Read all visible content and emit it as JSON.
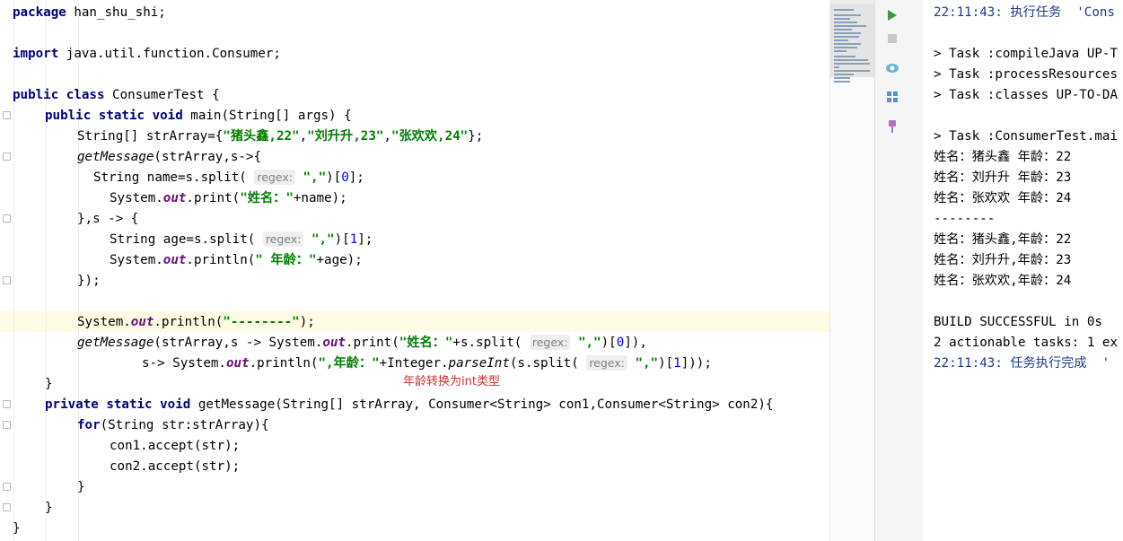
{
  "editor": {
    "lines": [
      {
        "row": 0,
        "segs": [
          {
            "t": "package",
            "c": "kw"
          },
          {
            "t": " han_shu_shi;"
          }
        ]
      },
      {
        "row": 2,
        "segs": [
          {
            "t": "import",
            "c": "kw"
          },
          {
            "t": " java.util.function.Consumer;"
          }
        ]
      },
      {
        "row": 4,
        "segs": [
          {
            "t": "public",
            "c": "kw"
          },
          {
            "t": " "
          },
          {
            "t": "class",
            "c": "kw"
          },
          {
            "t": " ConsumerTest {"
          }
        ]
      },
      {
        "row": 5,
        "indent": 36,
        "segs": [
          {
            "t": "public",
            "c": "kw"
          },
          {
            "t": " "
          },
          {
            "t": "static",
            "c": "kw"
          },
          {
            "t": " "
          },
          {
            "t": "void",
            "c": "kw"
          },
          {
            "t": " main(String[] args) {"
          }
        ]
      },
      {
        "row": 6,
        "indent": 72,
        "segs": [
          {
            "t": "String[] strArray={"
          },
          {
            "t": "\"猪头鑫,22\"",
            "c": "str"
          },
          {
            "t": ","
          },
          {
            "t": "\"刘升升,23\"",
            "c": "str"
          },
          {
            "t": ","
          },
          {
            "t": "\"张欢欢,24\"",
            "c": "str"
          },
          {
            "t": "};"
          }
        ]
      },
      {
        "row": 7,
        "indent": 72,
        "segs": [
          {
            "t": "getMessage",
            "c": "it"
          },
          {
            "t": "(strArray,s->{"
          }
        ]
      },
      {
        "row": 8,
        "indent": 90,
        "segs": [
          {
            "t": "String name=s.split( "
          },
          {
            "t": "regex:",
            "c": "hint"
          },
          {
            "t": " "
          },
          {
            "t": "\",\"",
            "c": "str"
          },
          {
            "t": ")["
          },
          {
            "t": "0",
            "c": "num"
          },
          {
            "t": "];"
          }
        ]
      },
      {
        "row": 9,
        "indent": 108,
        "segs": [
          {
            "t": "System."
          },
          {
            "t": "out",
            "c": "fld"
          },
          {
            "t": ".print("
          },
          {
            "t": "\"姓名：\"",
            "c": "str"
          },
          {
            "t": "+name);"
          }
        ]
      },
      {
        "row": 10,
        "indent": 72,
        "segs": [
          {
            "t": "},s -> {"
          }
        ]
      },
      {
        "row": 11,
        "indent": 108,
        "segs": [
          {
            "t": "String age=s.split( "
          },
          {
            "t": "regex:",
            "c": "hint"
          },
          {
            "t": " "
          },
          {
            "t": "\",\"",
            "c": "str"
          },
          {
            "t": ")["
          },
          {
            "t": "1",
            "c": "num"
          },
          {
            "t": "];"
          }
        ]
      },
      {
        "row": 12,
        "indent": 108,
        "segs": [
          {
            "t": "System."
          },
          {
            "t": "out",
            "c": "fld"
          },
          {
            "t": ".println("
          },
          {
            "t": "\" 年龄：\"",
            "c": "str"
          },
          {
            "t": "+age);"
          }
        ]
      },
      {
        "row": 13,
        "indent": 72,
        "segs": [
          {
            "t": "});"
          }
        ]
      },
      {
        "row": 15,
        "indent": 72,
        "segs": [
          {
            "t": "System."
          },
          {
            "t": "out",
            "c": "fld"
          },
          {
            "t": ".println("
          },
          {
            "t": "\"--------\"",
            "c": "str"
          },
          {
            "t": ");"
          }
        ]
      },
      {
        "row": 16,
        "indent": 72,
        "segs": [
          {
            "t": "getMessage",
            "c": "it"
          },
          {
            "t": "(strArray,s -> System."
          },
          {
            "t": "out",
            "c": "fld"
          },
          {
            "t": ".print("
          },
          {
            "t": "\"姓名：\"",
            "c": "str"
          },
          {
            "t": "+s.split( "
          },
          {
            "t": "regex:",
            "c": "hint"
          },
          {
            "t": " "
          },
          {
            "t": "\",\"",
            "c": "str"
          },
          {
            "t": ")["
          },
          {
            "t": "0",
            "c": "num"
          },
          {
            "t": "]),"
          }
        ]
      },
      {
        "row": 17,
        "indent": 144,
        "segs": [
          {
            "t": "s-> System."
          },
          {
            "t": "out",
            "c": "fld"
          },
          {
            "t": ".println("
          },
          {
            "t": "\",年龄：\"",
            "c": "str"
          },
          {
            "t": "+Integer."
          },
          {
            "t": "parseInt",
            "c": "it"
          },
          {
            "t": "(s.split( "
          },
          {
            "t": "regex:",
            "c": "hint"
          },
          {
            "t": " "
          },
          {
            "t": "\",\"",
            "c": "str"
          },
          {
            "t": ")["
          },
          {
            "t": "1",
            "c": "num"
          },
          {
            "t": "]));"
          }
        ]
      },
      {
        "row": 18,
        "indent": 36,
        "segs": [
          {
            "t": "}"
          }
        ]
      },
      {
        "row": 19,
        "indent": 36,
        "segs": [
          {
            "t": "private",
            "c": "kw"
          },
          {
            "t": " "
          },
          {
            "t": "static",
            "c": "kw"
          },
          {
            "t": " "
          },
          {
            "t": "void",
            "c": "kw"
          },
          {
            "t": " getMessage(String[] strArray, Consumer<String> con1,Consumer<String> con2){"
          }
        ]
      },
      {
        "row": 20,
        "indent": 72,
        "segs": [
          {
            "t": "for",
            "c": "kw"
          },
          {
            "t": "(String str:strArray){"
          }
        ]
      },
      {
        "row": 21,
        "indent": 108,
        "segs": [
          {
            "t": "con1.accept(str);"
          }
        ]
      },
      {
        "row": 22,
        "indent": 108,
        "segs": [
          {
            "t": "con2.accept(str);"
          }
        ]
      },
      {
        "row": 23,
        "indent": 72,
        "segs": [
          {
            "t": "}"
          }
        ]
      },
      {
        "row": 24,
        "indent": 36,
        "segs": [
          {
            "t": "}"
          }
        ]
      },
      {
        "row": 25,
        "segs": [
          {
            "t": "}"
          }
        ]
      }
    ],
    "annotation": "年龄转换为int类型"
  },
  "gutter_icons": [
    "run-icon",
    "stop-icon",
    "eye-icon",
    "layout-icon",
    "pin-icon"
  ],
  "console": {
    "lines": [
      {
        "row": 0,
        "t": "22:11:43: 执行任务  'Cons",
        "c": "blue"
      },
      {
        "row": 2,
        "t": "> Task :compileJava UP-T"
      },
      {
        "row": 3,
        "t": "> Task :processResources"
      },
      {
        "row": 4,
        "t": "> Task :classes UP-TO-DA"
      },
      {
        "row": 6,
        "t": "> Task :ConsumerTest.mai"
      },
      {
        "row": 7,
        "t": "姓名：猪头鑫 年龄：22"
      },
      {
        "row": 8,
        "t": "姓名：刘升升 年龄：23"
      },
      {
        "row": 9,
        "t": "姓名：张欢欢 年龄：24"
      },
      {
        "row": 10,
        "t": "--------"
      },
      {
        "row": 11,
        "t": "姓名：猪头鑫,年龄：22"
      },
      {
        "row": 12,
        "t": "姓名：刘升升,年龄：23"
      },
      {
        "row": 13,
        "t": "姓名：张欢欢,年龄：24"
      },
      {
        "row": 15,
        "t": "BUILD SUCCESSFUL in 0s"
      },
      {
        "row": 16,
        "t": "2 actionable tasks: 1 ex"
      },
      {
        "row": 17,
        "t": "22:11:43: 任务执行完成  '",
        "c": "blue"
      }
    ]
  }
}
